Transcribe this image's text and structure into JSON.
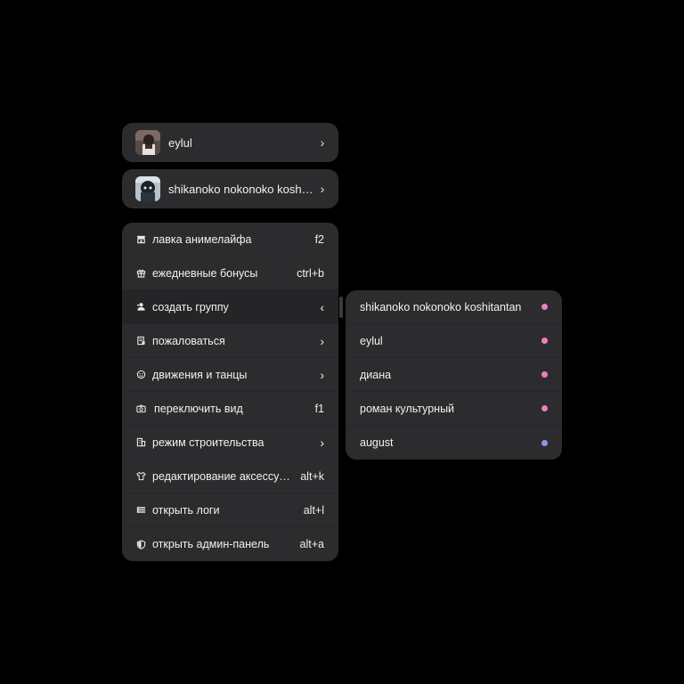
{
  "accounts": [
    {
      "name": "eylul",
      "avatar_icon": "avatar-eylul",
      "chevron": "›"
    },
    {
      "name": "shikanoko nokonoko koshitantan",
      "avatar_icon": "avatar-shikanoko",
      "chevron": "›"
    }
  ],
  "menu": {
    "items": [
      {
        "icon": "store-icon",
        "label": "лавка анимелайфа",
        "shortcut": "f2"
      },
      {
        "icon": "gift-icon",
        "label": "ежедневные бонусы",
        "shortcut": "ctrl+b"
      },
      {
        "icon": "user-plus-icon",
        "label": "создать группу",
        "shortcut": "‹"
      },
      {
        "icon": "report-icon",
        "label": "пожаловаться",
        "shortcut": "›"
      },
      {
        "icon": "smile-icon",
        "label": "движения и танцы",
        "shortcut": "›"
      },
      {
        "icon": "camera-icon",
        "label": "переключить вид",
        "shortcut": "f1"
      },
      {
        "icon": "building-icon",
        "label": "режим строительства",
        "shortcut": "›"
      },
      {
        "icon": "shirt-icon",
        "label": "редактирование аксессуаров",
        "shortcut": "alt+k"
      },
      {
        "icon": "list-icon",
        "label": "открыть логи",
        "shortcut": "alt+l"
      },
      {
        "icon": "shield-icon",
        "label": "открыть админ-панель",
        "shortcut": "alt+a"
      }
    ]
  },
  "submenu": {
    "items": [
      {
        "label": "shikanoko nokonoko koshitantan",
        "dot_color": "#f27cc0"
      },
      {
        "label": "eylul",
        "dot_color": "#f27cc0"
      },
      {
        "label": "диана",
        "dot_color": "#f27cc0"
      },
      {
        "label": "роман культурный",
        "dot_color": "#f27cc0"
      },
      {
        "label": "august",
        "dot_color": "#8a95f0"
      }
    ]
  },
  "colors": {
    "background": "#000000",
    "panel": "#2c2c2e",
    "active_row": "#252527",
    "pink_dot": "#f27cc0",
    "blue_dot": "#8a95f0"
  }
}
